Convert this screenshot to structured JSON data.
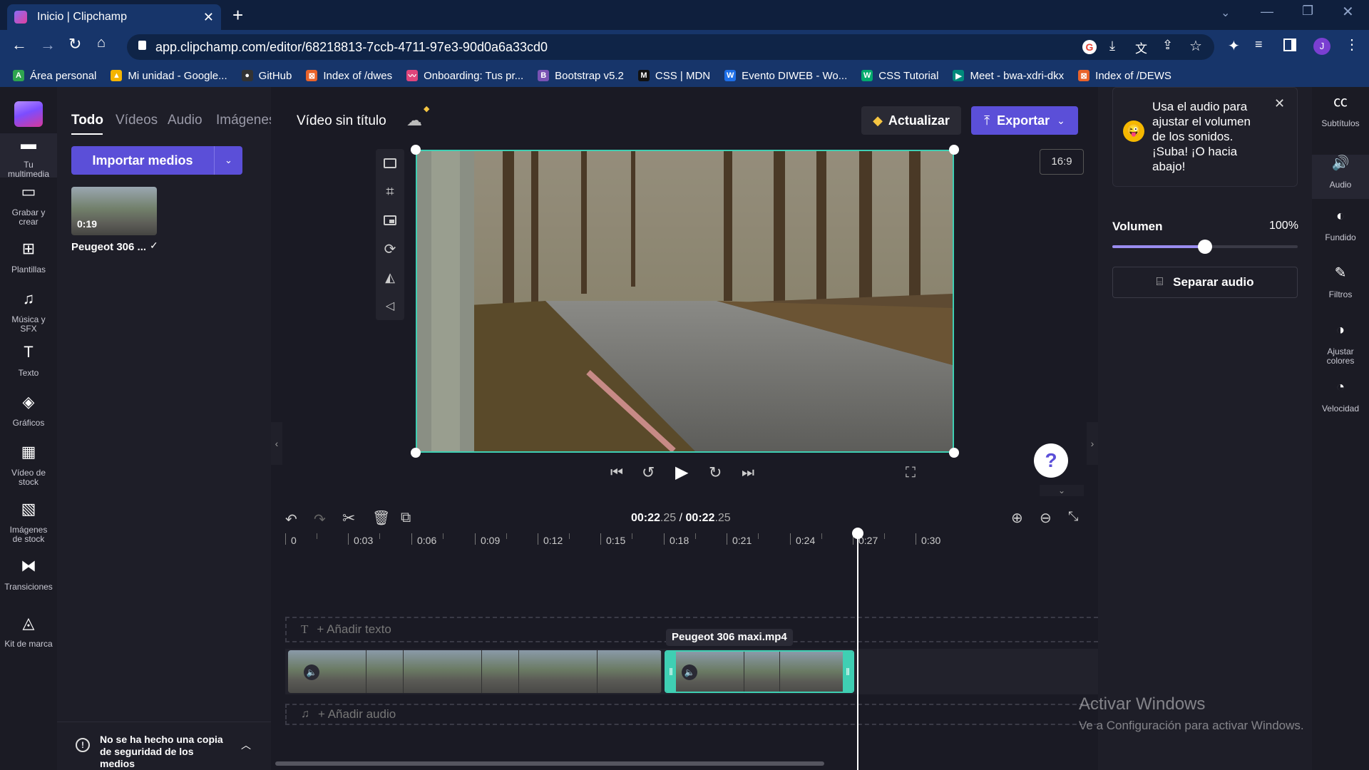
{
  "browser": {
    "tab_title": "Inicio | Clipchamp",
    "url": "app.clipchamp.com/editor/68218813-7ccb-4711-97e3-90d0a6a33cd0",
    "profile_initial": "J",
    "bookmarks": [
      {
        "label": "Área personal",
        "color": "#2ea44f",
        "glyph": "A"
      },
      {
        "label": "Mi unidad - Google...",
        "color": "#f4b400",
        "glyph": "▲"
      },
      {
        "label": "GitHub",
        "color": "#333333",
        "glyph": "●"
      },
      {
        "label": "Index of /dwes",
        "color": "#e8632b",
        "glyph": "⊠"
      },
      {
        "label": "Onboarding: Tus pr...",
        "color": "#e0457b",
        "glyph": "〰"
      },
      {
        "label": "Bootstrap v5.2",
        "color": "#7952b3",
        "glyph": "B"
      },
      {
        "label": "CSS | MDN",
        "color": "#111111",
        "glyph": "M"
      },
      {
        "label": "Evento DIWEB - Wo...",
        "color": "#1e6fe8",
        "glyph": "W"
      },
      {
        "label": "CSS Tutorial",
        "color": "#04aa6d",
        "glyph": "W"
      },
      {
        "label": "Meet - bwa-xdri-dkx",
        "color": "#00897b",
        "glyph": "▶"
      },
      {
        "label": "Index of /DEWS",
        "color": "#e8632b",
        "glyph": "⊠"
      }
    ]
  },
  "leftnav": [
    {
      "label": "Tu multimedia",
      "icon": "folder-icon",
      "active": true
    },
    {
      "label": "Grabar y crear",
      "icon": "camera-icon"
    },
    {
      "label": "Plantillas",
      "icon": "templates-icon"
    },
    {
      "label": "Música y SFX",
      "icon": "music-icon"
    },
    {
      "label": "Texto",
      "icon": "text-icon"
    },
    {
      "label": "Gráficos",
      "icon": "shapes-icon"
    },
    {
      "label": "Vídeo de stock",
      "icon": "film-icon"
    },
    {
      "label": "Imágenes de stock",
      "icon": "image-icon"
    },
    {
      "label": "Transiciones",
      "icon": "transition-icon"
    },
    {
      "label": "Kit de marca",
      "icon": "brand-icon"
    }
  ],
  "media": {
    "tabs": [
      "Todo",
      "Vídeos",
      "Audio",
      "Imágenes"
    ],
    "import_label": "Importar medios",
    "item_duration": "0:19",
    "item_name": "Peugeot 306 ...",
    "backup_notice": "No se ha hecho una copia de seguridad de los medios"
  },
  "editor": {
    "project_title": "Vídeo sin título",
    "upgrade_label": "Actualizar",
    "export_label": "Exportar",
    "aspect_ratio": "16:9",
    "help": "?"
  },
  "timeline": {
    "time_current": "00:22",
    "time_current_frac": ".25",
    "time_sep": " / ",
    "time_total": "00:22",
    "time_total_frac": ".25",
    "ruler": [
      "0",
      "0:03",
      "0:06",
      "0:09",
      "0:12",
      "0:15",
      "0:18",
      "0:21",
      "0:24",
      "0:27",
      "0:30"
    ],
    "add_text": "+ Añadir texto",
    "add_audio": "+ Añadir audio",
    "clip_tooltip": "Peugeot 306 maxi.mp4"
  },
  "right_panel": {
    "tip": "Usa el audio para ajustar el volumen de los sonidos. ¡Suba! ¡O hacia abajo!",
    "volume_label": "Volumen",
    "volume_value": "100%",
    "volume_fraction": 0.5,
    "separate_label": "Separar audio"
  },
  "rightnav": [
    {
      "label": "Subtítulos",
      "icon": "cc-icon"
    },
    {
      "label": "Audio",
      "icon": "speaker-icon",
      "active": true
    },
    {
      "label": "Fundido",
      "icon": "fade-icon"
    },
    {
      "label": "Filtros",
      "icon": "filters-icon"
    },
    {
      "label": "Ajustar colores",
      "icon": "contrast-icon"
    },
    {
      "label": "Velocidad",
      "icon": "speed-icon"
    }
  ],
  "watermark": {
    "title": "Activar Windows",
    "subtitle": "Ve a Configuración para activar Windows."
  }
}
